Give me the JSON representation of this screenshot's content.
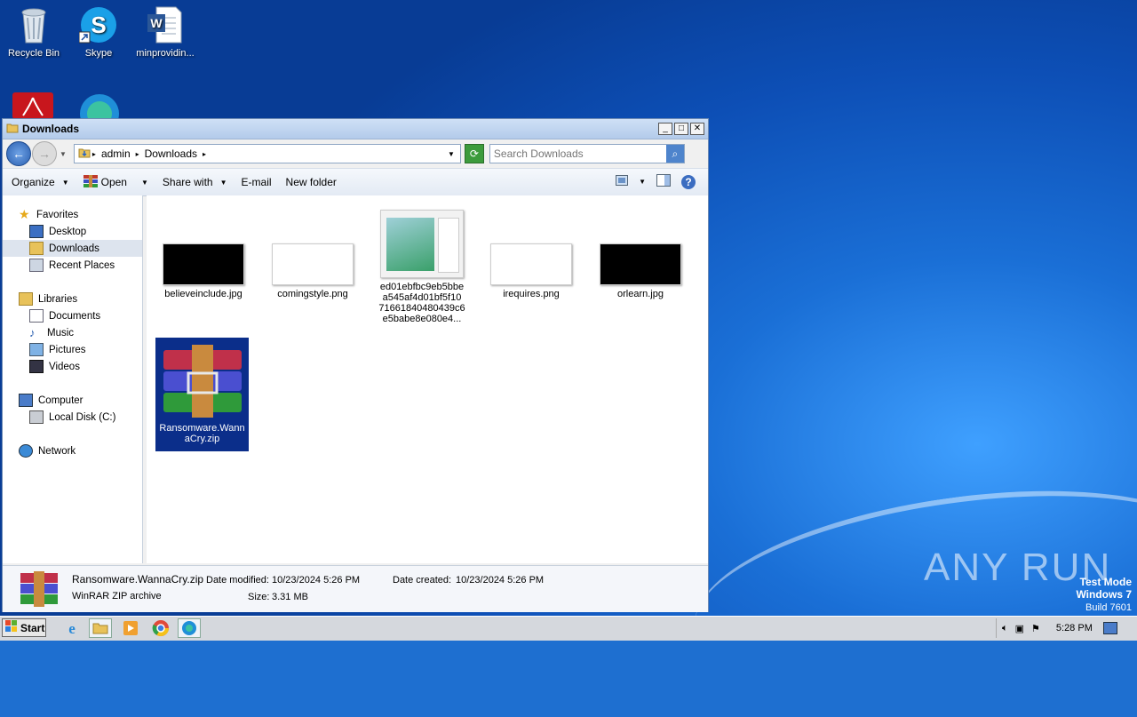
{
  "desktop": {
    "icons": [
      {
        "label": "Recycle Bin",
        "icon": "recycle-bin-icon"
      },
      {
        "label": "Skype",
        "icon": "skype-icon"
      },
      {
        "label": "minprovidin...",
        "icon": "word-document-icon"
      }
    ]
  },
  "window": {
    "title": "Downloads",
    "controls": {
      "minimize": "_",
      "maximize": "□",
      "close": "✕"
    },
    "breadcrumb": [
      "admin",
      "Downloads"
    ],
    "search_placeholder": "Search Downloads",
    "toolbar": {
      "organize": "Organize",
      "open": "Open",
      "share_with": "Share with",
      "email": "E-mail",
      "new_folder": "New folder"
    }
  },
  "navpane": {
    "favorites": {
      "label": "Favorites",
      "items": [
        "Desktop",
        "Downloads",
        "Recent Places"
      ]
    },
    "libraries": {
      "label": "Libraries",
      "items": [
        "Documents",
        "Music",
        "Pictures",
        "Videos"
      ]
    },
    "computer": {
      "label": "Computer",
      "items": [
        "Local Disk (C:)"
      ]
    },
    "network": {
      "label": "Network"
    },
    "selected": "Downloads"
  },
  "files": [
    {
      "name": "believeinclude.jpg",
      "thumb": "black"
    },
    {
      "name": "comingstyle.png",
      "thumb": "white"
    },
    {
      "name": "ed01ebfbc9eb5bbea545af4d01bf5f1071661840480439c6e5babe8e080e4...",
      "name_lines": [
        "ed01ebfbc9eb5bbe",
        "a545af4d01bf5f10",
        "71661840480439c6",
        "e5babe8e080e4..."
      ],
      "thumb": "screenshot"
    },
    {
      "name": "irequires.png",
      "thumb": "white"
    },
    {
      "name": "orlearn.jpg",
      "thumb": "black"
    },
    {
      "name": "Ransomware.WannaCry.zip",
      "name_lines": [
        "Ransomware.Wann",
        "aCry.zip"
      ],
      "thumb": "winrar",
      "selected": true
    }
  ],
  "details": {
    "name": "Ransomware.WannaCry.zip",
    "type": "WinRAR ZIP archive",
    "date_modified_label": "Date modified:",
    "date_modified": "10/23/2024 5:26 PM",
    "date_created_label": "Date created:",
    "date_created": "10/23/2024 5:26 PM",
    "size_label": "Size:",
    "size": "3.31 MB"
  },
  "taskbar": {
    "start": "Start",
    "clock": "5:28 PM"
  },
  "watermark": {
    "line1": "Test Mode",
    "line2": "Windows 7",
    "line3": "Build 7601",
    "brand": "ANY RUN"
  },
  "colors": {
    "desktop": "#1a6fd6",
    "selection": "#0b2e8a",
    "titlebar": "#b3cbea"
  }
}
